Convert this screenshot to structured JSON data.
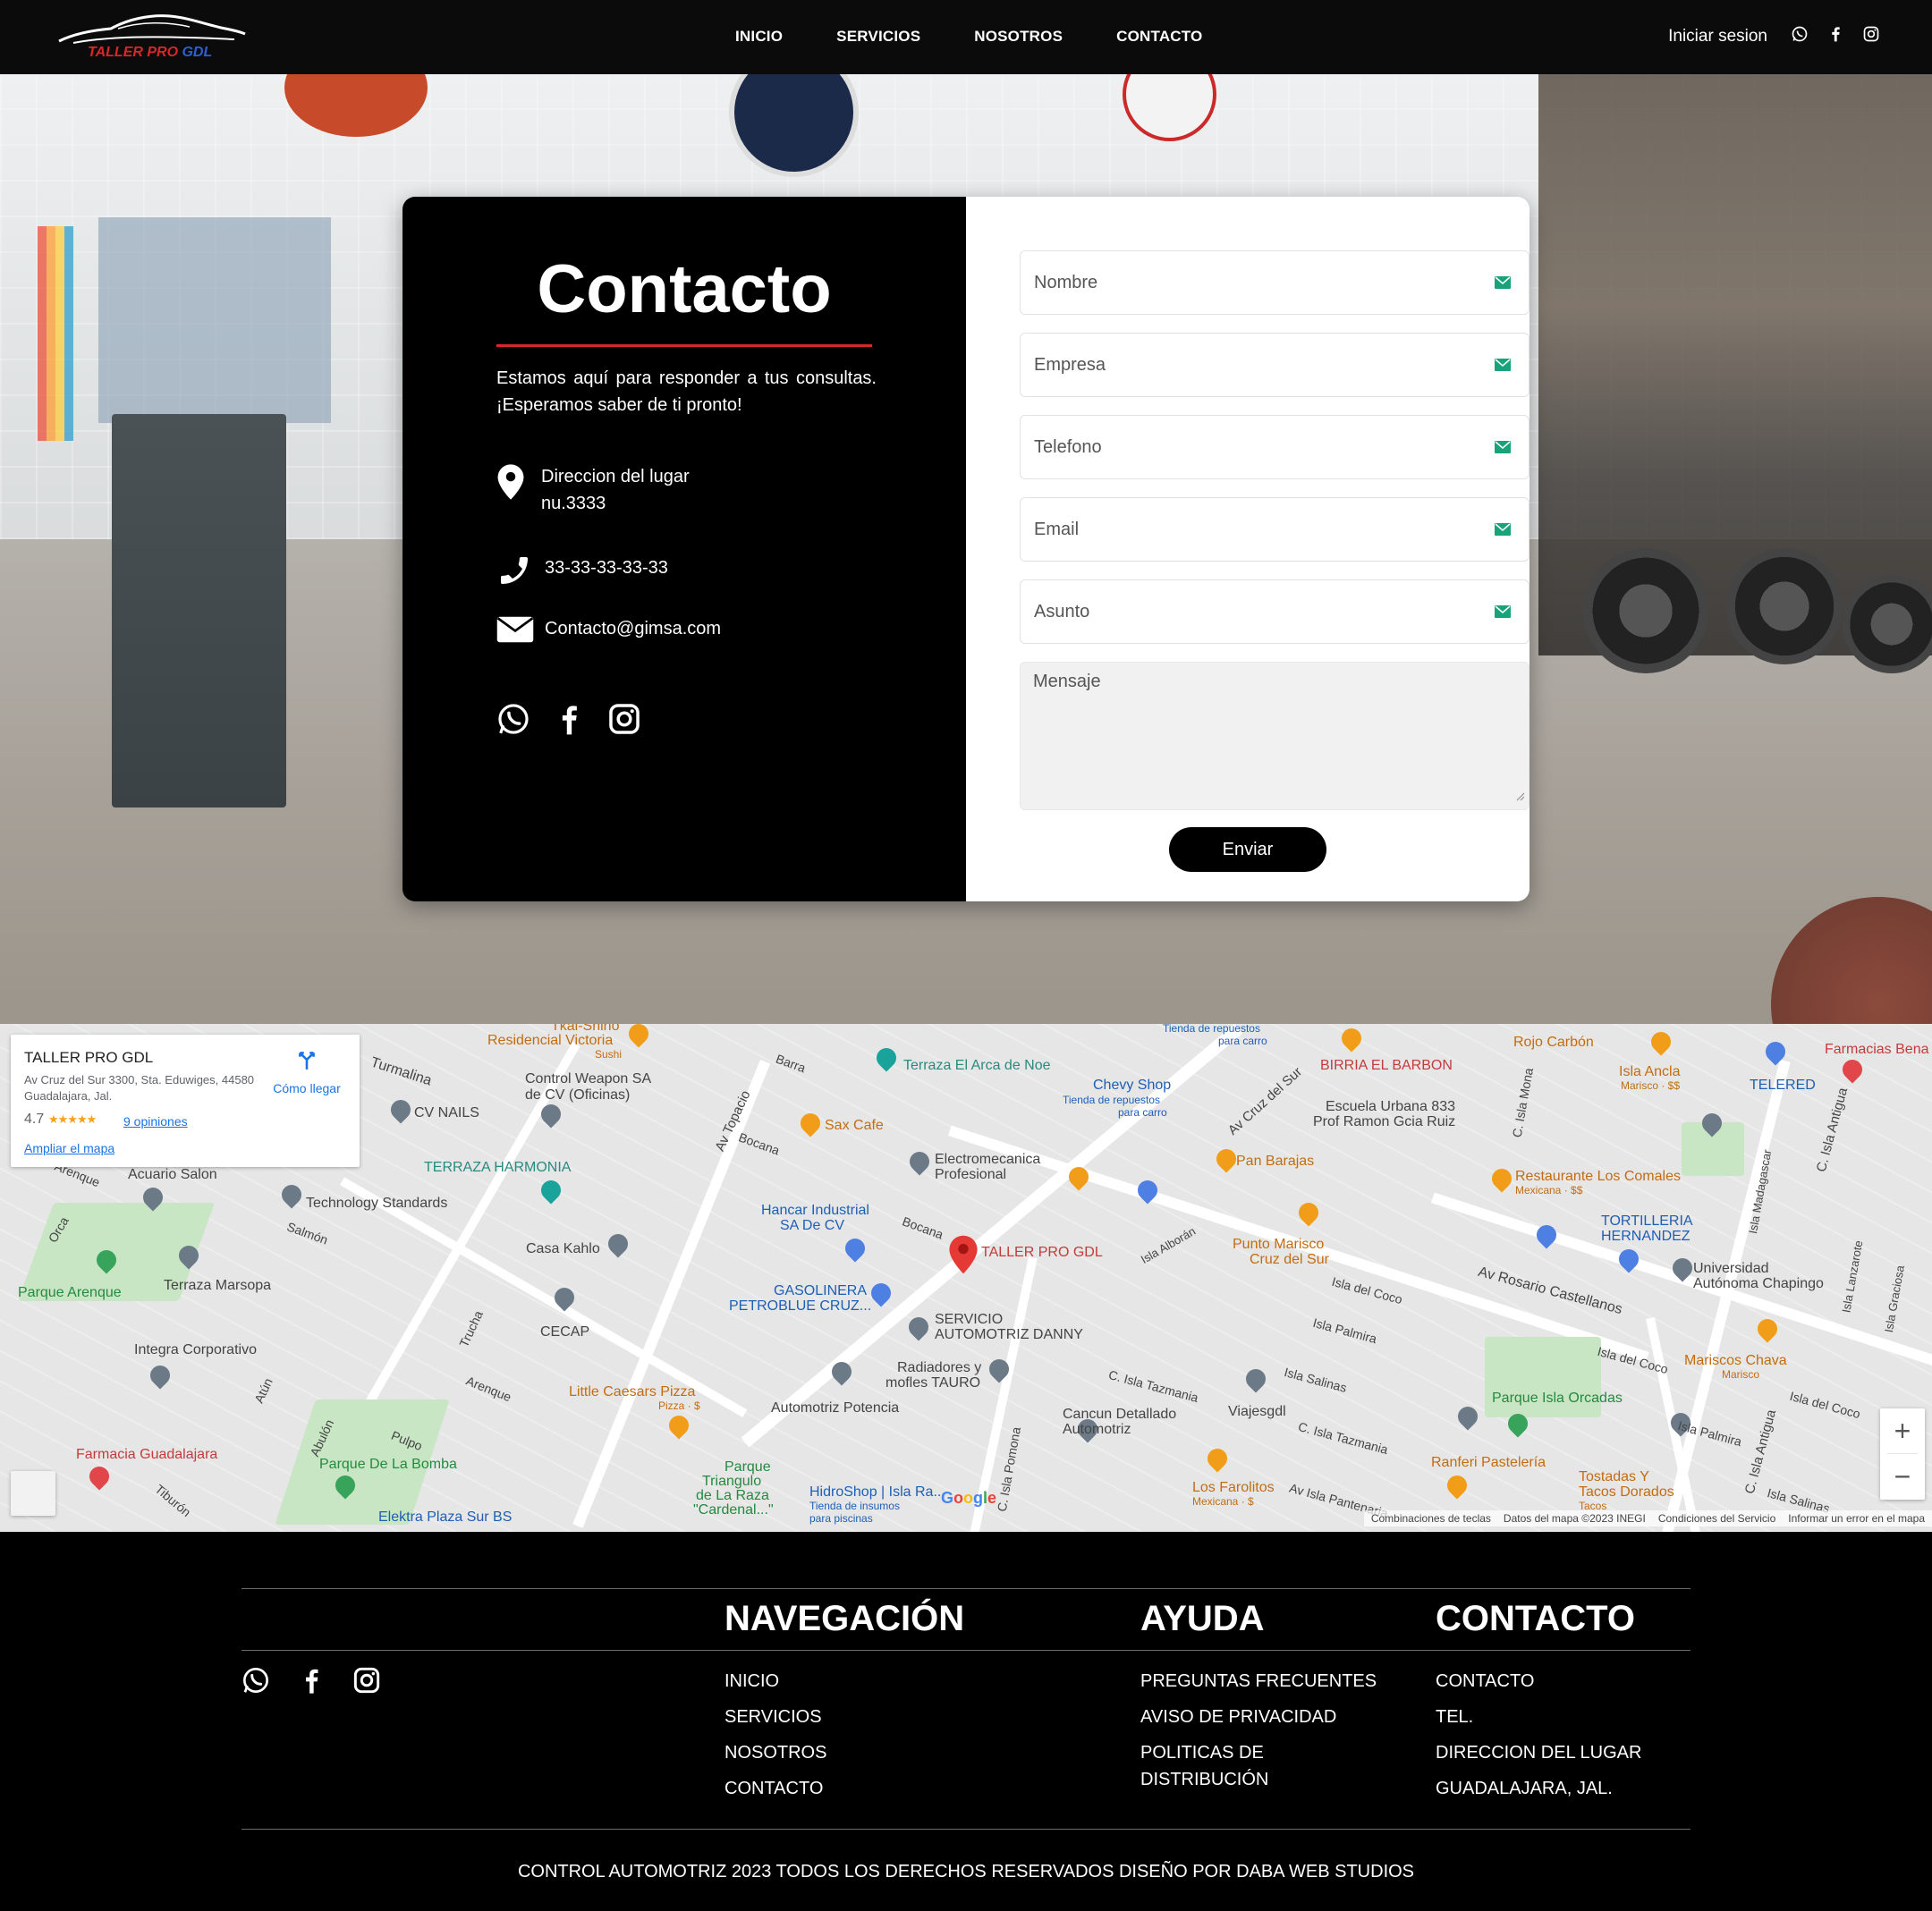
{
  "brand": {
    "logo_part1": "TALLER PRO",
    "logo_part2": "GDL",
    "red": "#d7272a",
    "blue": "#2d5fd1"
  },
  "header": {
    "nav": [
      "INICIO",
      "SERVICIOS",
      "NOSOTROS",
      "CONTACTO"
    ],
    "login_label": "Iniciar sesion",
    "social_icons": [
      "whatsapp-icon",
      "facebook-icon",
      "instagram-icon"
    ]
  },
  "contact": {
    "title": "Contacto",
    "description": "Estamos aquí para responder a tus consultas. ¡Esperamos saber de ti pronto!",
    "address_line1": "Direccion del lugar",
    "address_line2": "nu.3333",
    "phone": "33-33-33-33-33",
    "email": "Contacto@gimsa.com"
  },
  "form": {
    "name_placeholder": "Nombre",
    "company_placeholder": "Empresa",
    "phone_placeholder": "Telefono",
    "email_placeholder": "Email",
    "subject_placeholder": "Asunto",
    "message_placeholder": "Mensaje",
    "submit_label": "Enviar"
  },
  "map": {
    "place_name": "TALLER PRO GDL",
    "place_address": "Av Cruz del Sur 3300, Sta. Eduwiges, 44580 Guadalajara, Jal.",
    "rating": "4.7",
    "stars": "★★★★★",
    "reviews": "9 opiniones",
    "directions": "Cómo llegar",
    "expand": "Ampliar el mapa",
    "main_pin_label": "TALLER PRO GDL",
    "zoom_in": "+",
    "zoom_out": "−",
    "google": "Google",
    "attribution": [
      "Combinaciones de teclas",
      "Datos del mapa ©2023 INEGI",
      "Condiciones del Servicio",
      "Informar un error en el mapa"
    ],
    "labels": {
      "tkai_shino": "Tkai-Shino",
      "residencial_victoria": "Residencial Victoria",
      "sushi": "Sushi",
      "turmalina": "Turmalina",
      "control_weapon": "Control Weapon SA",
      "control_weapon2": "de CV (Oficinas)",
      "cv_nails": "CV NAILS",
      "terraza_harmonia": "TERRAZA HARMONIA",
      "acuario_salon": "Acuario Salon",
      "technology_standards": "Technology Standards",
      "salmon": "Salmón",
      "parque_arenque": "Parque Arenque",
      "terraza_marsopa": "Terraza Marsopa",
      "casa_kahlo": "Casa Kahlo",
      "cecap": "CECAP",
      "integra": "Integra Corporativo",
      "barra": "Barra",
      "av_topacio": "Av Topacio",
      "bocana": "Bocana",
      "terraza_arca": "Terraza El Arca de Noe",
      "sax_cafe": "Sax Cafe",
      "electromecanica": "Electromecanica",
      "profesional": "Profesional",
      "hancar": "Hancar Industrial",
      "hancar2": "SA De CV",
      "gasolinera": "GASOLINERA",
      "petroblue": "PETROBLUE CRUZ...",
      "servicio_danny": "SERVICIO",
      "servicio_danny2": "AUTOMOTRIZ DANNY",
      "radiadores": "Radiadores y",
      "mofles": "mofles TAURO",
      "automotriz_potencia": "Automotriz Potencia",
      "little_caesars": "Little Caesars Pizza",
      "pizza_price": "Pizza · $",
      "trucha": "Trucha",
      "arenque": "Arenque",
      "atun": "Atún",
      "abulon": "Abulón",
      "pulpo": "Pulpo",
      "parque_bomba": "Parque De La Bomba",
      "farmacia_gdl": "Farmacia Guadalajara",
      "tiburon": "Tiburón",
      "elektra": "Elektra Plaza Sur BS",
      "parque_triangulo": "Parque",
      "parque_triangulo2": "Triangulo",
      "parque_triangulo3": "de La Raza",
      "parque_triangulo4": "\"Cardenal...\"",
      "hidroshop": "HidroShop | Isla Ra...",
      "hidroshop2": "Tienda de insumos",
      "hidroshop3": "para piscinas",
      "tienda_repuestos": "Tienda de repuestos",
      "para_carro": "para carro",
      "chevy_shop": "Chevy Shop",
      "chevy_sub": "Tienda de repuestos",
      "chevy_sub2": "para carro",
      "av_cruz_sur": "Av Cruz del Sur",
      "birria": "BIRRIA EL BARBON",
      "escuela": "Escuela Urbana 833",
      "escuela2": "Prof Ramon Gcia Ruiz",
      "pan_barajas": "Pan Barajas",
      "isla_alboran": "Isla Alborán",
      "punto_marisco": "Punto Marisco",
      "punto_marisco2": "Cruz del Sur",
      "c_isla_tazmania": "C. Isla Tazmania",
      "viajesgdl": "Viajesgdl",
      "cancun": "Cancun Detallado",
      "cancun2": "Automotriz",
      "c_isla_pomona": "C. Isla Pomona",
      "los_farolitos": "Los Farolitos",
      "mexicana_s": "Mexicana · $",
      "av_isla_pantenaria": "Av Isla Pantenaria",
      "rojo_carbon": "Rojo Carbón",
      "isla_ancla": "Isla Ancla",
      "marisco_ss": "Marisco · $$",
      "telered": "TELERED",
      "farmacias_bena": "Farmacias Bena",
      "c_isla_mona": "C. Isla Mona",
      "restaurante_comales": "Restaurante Los Comales",
      "mexicana_ss": "Mexicana · $$",
      "tortilleria": "TORTILLERIA",
      "tortilleria2": "HERNANDEZ",
      "universidad": "Universidad",
      "universidad2": "Autónoma Chapingo",
      "av_rosario": "Av Rosario Castellanos",
      "isla_del_coco": "Isla del Coco",
      "isla_palmira": "Isla Palmira",
      "isla_salinas": "Isla Salinas",
      "mariscos_chava": "Mariscos Chava",
      "marisco": "Marisco",
      "parque_orcadas": "Parque Isla Orcadas",
      "ranferi": "Ranferi Pastelería",
      "tostadas": "Tostadas Y",
      "tostadas2": "Tacos Dorados",
      "tacos": "Tacos",
      "c_isla_antigua": "C. Isla Antigua",
      "isla_madagascar": "Isla Madagascar",
      "isla_lanzarote": "Isla Lanzarote",
      "isla_graciosa": "Isla Graciosa",
      "orca": "Orca",
      "isla_salinas2": "Isla Salinas",
      "isla_palmira2": "Isla Palmira",
      "isla_del_coco2": "Isla del Coco",
      "isla_del_coco3": "Isla del Coco",
      "c_isla_tazmania2": "C. Isla Tazmania"
    }
  },
  "footer": {
    "nav_title": "NAVEGACIÓN",
    "help_title": "AYUDA",
    "contact_title": "CONTACTO",
    "nav_links": [
      "INICIO",
      "SERVICIOS",
      "NOSOTROS",
      "CONTACTO"
    ],
    "help_links": [
      "PREGUNTAS FRECUENTES",
      "AVISO DE PRIVACIDAD",
      "POLITICAS DE DISTRIBUCIÓN"
    ],
    "contact_links": [
      "CONTACTO",
      "TEL.",
      "DIRECCION DEL LUGAR",
      "GUADALAJARA, JAL."
    ],
    "copyright": "CONTROL AUTOMOTRIZ 2023 TODOS LOS DERECHOS RESERVADOS DISEÑO POR DABA WEB STUDIOS"
  }
}
